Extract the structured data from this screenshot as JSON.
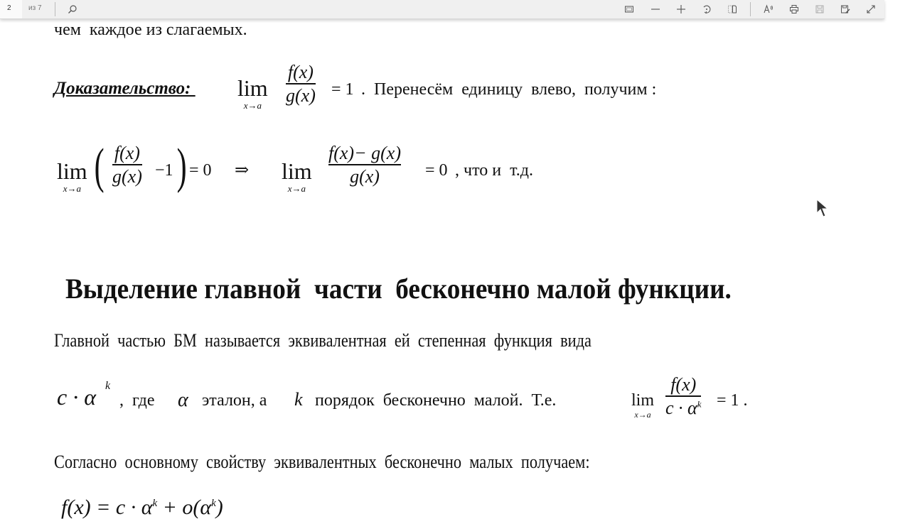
{
  "toolbar": {
    "page_current": "2",
    "page_total": "из 7",
    "icons": [
      "search-icon",
      "fit-page-icon",
      "zoom-out-icon",
      "zoom-in-icon",
      "rotate-icon",
      "page-view-icon",
      "read-aloud-icon",
      "print-icon",
      "save-icon",
      "save-as-icon",
      "fullscreen-icon"
    ],
    "read_aloud_label": "A"
  },
  "document": {
    "line1": "чем  каждое из слагаемых.",
    "proof_label": "Доказательство: ",
    "lim": "lim",
    "lim_sub": "x→a",
    "f_of_x": "f(x)",
    "g_of_x": "g(x)",
    "eq_one": "= 1",
    "proof_text": ".  Перенесём  единицу  влево,  получим :",
    "minus_one": "−1",
    "eq_zero": "= 0",
    "implies": "⇒",
    "f_minus_g": "f(x)− g(x)",
    "eq_zero_end": "= 0",
    "qed_text": ", что и  т.д.",
    "heading": "Выделение главной  части  бесконечно малой функции.",
    "para1": "Главной  частью  БМ  называется  эквивалентная  ей  степенная  функция  вида",
    "c_alpha": "c · α",
    "k": "k",
    "para2_a": ",  где",
    "alpha": "α",
    "para2_b": "эталон, а",
    "para2_c": "порядок  бесконечно  малой.  Т.е.",
    "eq_one_dot": "= 1 .",
    "para3": "Согласно  основному  свойству  эквивалентных  бесконечно  малых  получаем:",
    "partial_formula": "f(x) = c · α",
    "partial_formula_tail": " + o(α",
    "partial_formula_end": ")"
  }
}
